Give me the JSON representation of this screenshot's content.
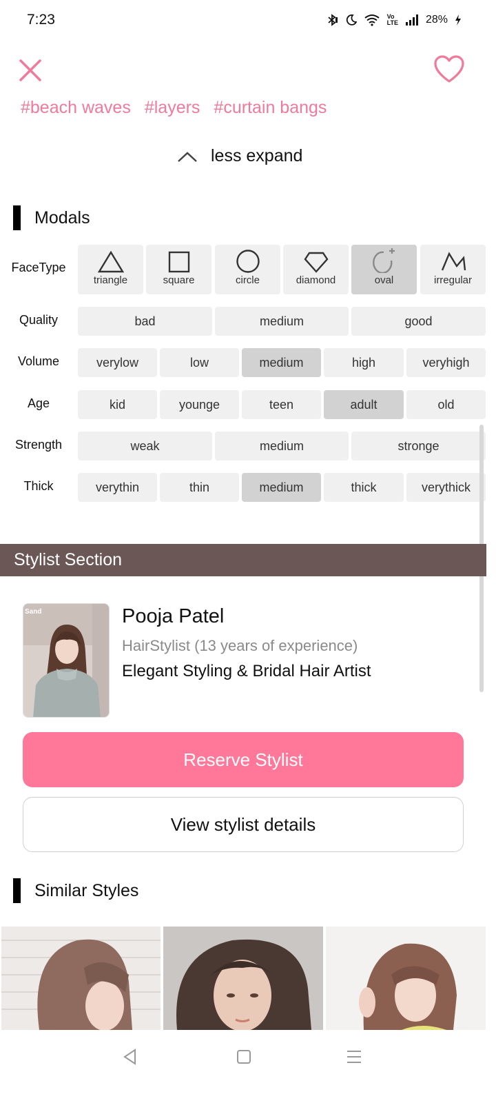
{
  "status": {
    "time": "7:23",
    "battery": "28%",
    "network_badge_top": "Vo",
    "network_badge_bottom": "LTE",
    "icons": [
      "bluetooth-icon",
      "moon-icon",
      "wifi-icon",
      "volte-icon",
      "signal-icon",
      "battery-charging-icon"
    ]
  },
  "header": {
    "close_icon": "close-icon",
    "favorite_icon": "heart-icon"
  },
  "tags": [
    "#beach waves",
    "#layers",
    "#curtain bangs"
  ],
  "expand": {
    "label": "less expand",
    "icon": "chevron-up-icon"
  },
  "modals": {
    "title": "Modals",
    "face_type": {
      "label": "FaceType",
      "options": [
        "triangle",
        "square",
        "circle",
        "diamond",
        "oval",
        "irregular"
      ],
      "selected": "oval"
    },
    "quality": {
      "label": "Quality",
      "options": [
        "bad",
        "medium",
        "good"
      ],
      "selected": ""
    },
    "volume": {
      "label": "Volume",
      "options": [
        "verylow",
        "low",
        "medium",
        "high",
        "veryhigh"
      ],
      "selected": "medium"
    },
    "age": {
      "label": "Age",
      "options": [
        "kid",
        "younge",
        "teen",
        "adult",
        "old"
      ],
      "selected": "adult"
    },
    "strength": {
      "label": "Strength",
      "options": [
        "weak",
        "medium",
        "stronge"
      ],
      "selected": ""
    },
    "thick": {
      "label": "Thick",
      "options": [
        "verythin",
        "thin",
        "medium",
        "thick",
        "verythick"
      ],
      "selected": "medium"
    }
  },
  "stylist": {
    "section_title": "Stylist Section",
    "name": "Pooja Patel",
    "experience": "HairStylist (13 years of experience)",
    "tagline": "Elegant Styling & Bridal Hair Artist",
    "photo_sign": "Sand",
    "reserve_label": "Reserve Stylist",
    "details_label": "View stylist details"
  },
  "similar": {
    "title": "Similar Styles"
  },
  "colors": {
    "accent": "#ff7899",
    "tag": "#f07a9a",
    "header_bg": "#6b5756",
    "selected": "#d2d2d2"
  },
  "nav": {
    "icons": [
      "back-icon",
      "home-icon",
      "recents-icon"
    ]
  }
}
